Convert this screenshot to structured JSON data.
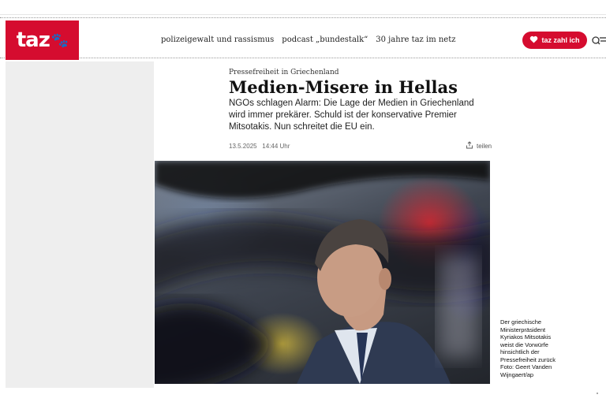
{
  "header": {
    "logo_text": "taz",
    "logo_color": "#d50c2f",
    "nav_links": [
      "polizeigewalt und rassismus",
      "podcast „bundestalk“",
      "30 jahre taz im netz"
    ],
    "donate_label": "taz zahl ich",
    "icons": [
      "heart-icon",
      "menu-search-icon",
      "paw-icon"
    ]
  },
  "article": {
    "kicker": "Pressefreiheit in Griechenland",
    "headline": "Medien-Misere in Hellas",
    "lead": "NGOs schlagen Alarm: Die Lage der Medien in Griechenland wird immer prekärer. Schuld ist der konservative Premier Mitsotakis. Nun schreitet die EU ein.",
    "date": "13.5.2025",
    "time": "14:44 Uhr",
    "share_label": "teilen",
    "image_caption": "Der griechische Ministerpräsident Kyriakos Mitsotakis weist die Vorwürfe hinsichtlich der Pressefreiheit zurück",
    "image_credit": "Foto: Geert Vanden Wijngaert/ap"
  }
}
